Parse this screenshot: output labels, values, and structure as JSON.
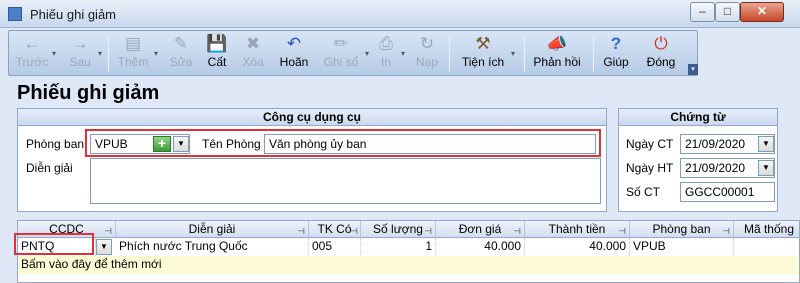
{
  "window": {
    "title": "Phiếu ghi giảm",
    "min": "–",
    "max": "□",
    "close": "✕"
  },
  "toolbar": {
    "buttons": [
      {
        "label": "Trước",
        "icon": "←",
        "enabled": false
      },
      {
        "label": "Sau",
        "icon": "→",
        "enabled": false
      },
      {
        "label": "Thêm",
        "icon": "▤",
        "enabled": false
      },
      {
        "label": "Sửa",
        "icon": "✎",
        "enabled": false
      },
      {
        "label": "Cất",
        "icon": "💾",
        "enabled": true
      },
      {
        "label": "Xóa",
        "icon": "✖",
        "enabled": false
      },
      {
        "label": "Hoãn",
        "icon": "↶",
        "enabled": true
      },
      {
        "label": "Ghi sổ",
        "icon": "✏",
        "enabled": false
      },
      {
        "label": "In",
        "icon": "⎙",
        "enabled": false
      },
      {
        "label": "Nạp",
        "icon": "↻",
        "enabled": false
      },
      {
        "label": "Tiện ích",
        "icon": "⚒",
        "enabled": true
      },
      {
        "label": "Phản hồi",
        "icon": "📣",
        "enabled": true
      },
      {
        "label": "Giúp",
        "icon": "?",
        "enabled": true
      },
      {
        "label": "Đóng",
        "icon": "⏻",
        "enabled": true
      }
    ]
  },
  "page_title": "Phiếu ghi giảm",
  "tool_group": {
    "title": "Công cụ dụng cụ",
    "department_label": "Phòng ban",
    "department_value": "VPUB",
    "department_name_label": "Tên Phòng",
    "department_name_value": "Văn phòng ủy ban",
    "description_label": "Diễn giải",
    "description_value": ""
  },
  "voucher_group": {
    "title": "Chứng từ",
    "voucher_date_label": "Ngày CT",
    "voucher_date": "21/09/2020",
    "accounting_date_label": "Ngày HT",
    "accounting_date": "21/09/2020",
    "voucher_no_label": "Số CT",
    "voucher_no": "GGCC00001"
  },
  "grid": {
    "columns": [
      "CCDC",
      "Diễn giải",
      "TK Có",
      "Số lượng",
      "Đơn giá",
      "Thành tiền",
      "Phòng ban",
      "Mã thống"
    ],
    "rows": [
      {
        "ccdc": "PNTQ",
        "description": "Phích nước Trung Quốc",
        "account": "005",
        "quantity": "1",
        "unit_price": "40.000",
        "amount": "40.000",
        "department": "VPUB"
      }
    ],
    "new_row_hint": "Bấm vào đây để thêm mới"
  },
  "colors": {
    "highlight": "#e0303a",
    "new_row_bg": "#fdfbd6"
  }
}
